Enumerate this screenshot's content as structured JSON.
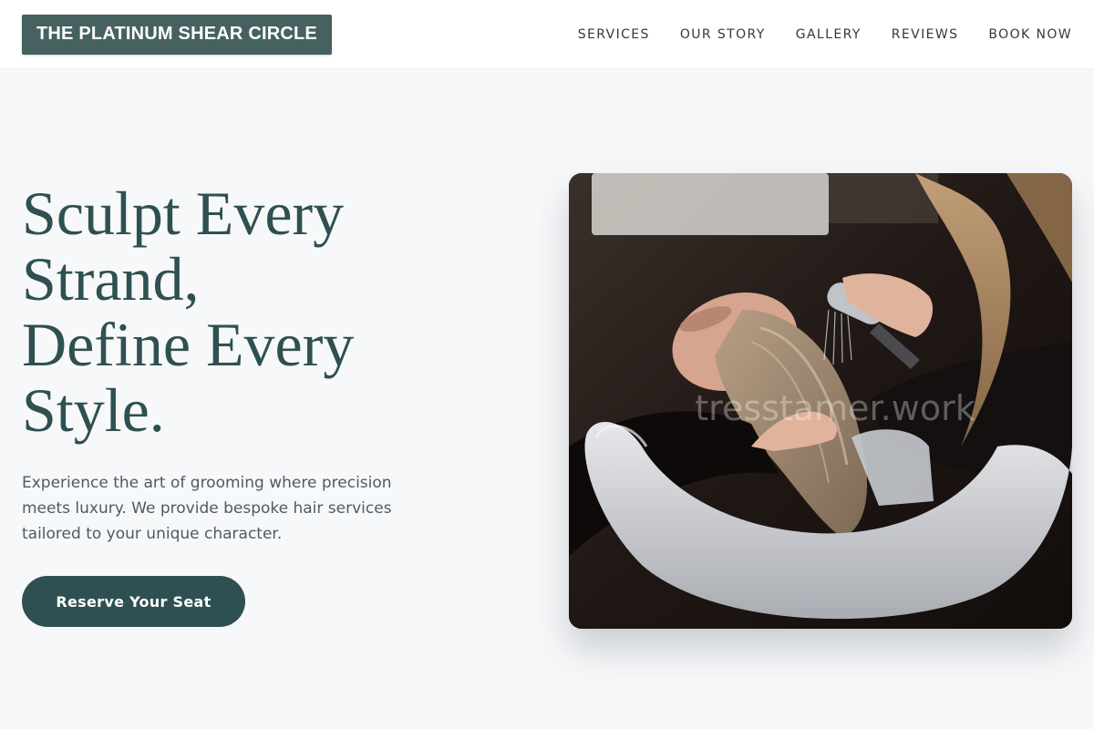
{
  "brand": {
    "name": "THE PLATINUM SHEAR CIRCLE"
  },
  "nav": {
    "items": [
      {
        "label": "SERVICES"
      },
      {
        "label": "OUR STORY"
      },
      {
        "label": "GALLERY"
      },
      {
        "label": "REVIEWS"
      },
      {
        "label": "BOOK NOW"
      }
    ]
  },
  "hero": {
    "headline_lines": [
      "Sculpt Every",
      "Strand,",
      "Define Every",
      "Style."
    ],
    "description": "Experience the art of grooming where precision meets luxury. We provide bespoke hair services tailored to your unique character.",
    "cta_label": "Reserve Your Seat"
  },
  "photo": {
    "subject": "stylist washing client's hair at salon basin",
    "watermark": "tresstamer.work"
  },
  "colors": {
    "brand_teal": "#2f5052",
    "logo_bg": "#456260",
    "page_bg": "#f7f8fa",
    "body_text": "#4f5a62"
  }
}
